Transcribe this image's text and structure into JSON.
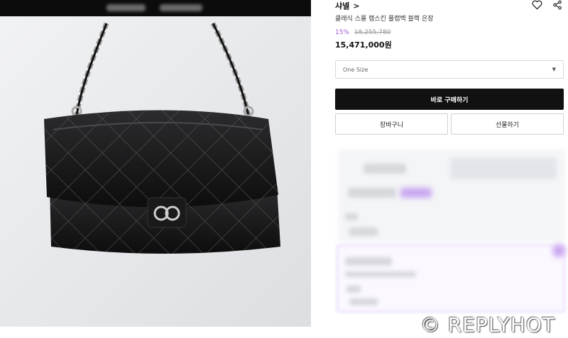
{
  "product": {
    "brand": "샤넬",
    "brand_chevron": ">",
    "name": "클래식 스몰 램스킨 플랩백 블랙 은장",
    "discount": "15%",
    "original_price": "18,255,780",
    "price": "15,471,000원"
  },
  "option": {
    "selected": "One Size",
    "caret": "▼"
  },
  "buttons": {
    "buy": "바로 구매하기",
    "cart": "장바구니",
    "gift": "선물하기"
  },
  "icons": {
    "wishlist": "heart-icon",
    "share": "share-icon"
  },
  "watermark": "© REPLYHOT",
  "colors": {
    "accent": "#a05bd5",
    "buy_button": "#111111"
  }
}
